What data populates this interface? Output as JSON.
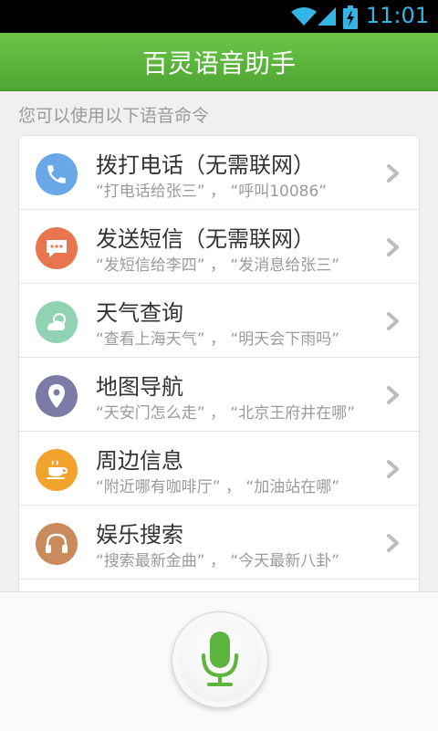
{
  "status_bar": {
    "time": "11:01",
    "icons": [
      "wifi-icon",
      "signal-icon",
      "battery-charging-icon"
    ]
  },
  "header": {
    "title": "百灵语音助手"
  },
  "subtitle": "您可以使用以下语音命令",
  "commands": [
    {
      "title": "拨打电话（无需联网）",
      "example": "“打电话给张三” ， “呼叫10086”",
      "icon": "phone-icon",
      "color": "#6aa7e6"
    },
    {
      "title": "发送短信（无需联网）",
      "example": "“发短信给李四” ， “发消息给张三”",
      "icon": "message-icon",
      "color": "#e9754f"
    },
    {
      "title": "天气查询",
      "example": "“查看上海天气” ， “明天会下雨吗”",
      "icon": "weather-icon",
      "color": "#8fd3b3"
    },
    {
      "title": "地图导航",
      "example": "“天安门怎么走” ， “北京王府井在哪”",
      "icon": "map-pin-icon",
      "color": "#7c7ba8"
    },
    {
      "title": "周边信息",
      "example": "“附近哪有咖啡厅” ， “加油站在哪”",
      "icon": "coffee-icon",
      "color": "#f2a32e"
    },
    {
      "title": "娱乐搜索",
      "example": "“搜索最新金曲” ， “今天最新八卦”",
      "icon": "headphones-icon",
      "color": "#c98a5c"
    }
  ],
  "colors": {
    "header_green": "#5cb63e",
    "mic_green": "#5cb63e",
    "status_blue": "#33b5e5"
  },
  "mic_button": {
    "icon": "microphone-icon"
  }
}
